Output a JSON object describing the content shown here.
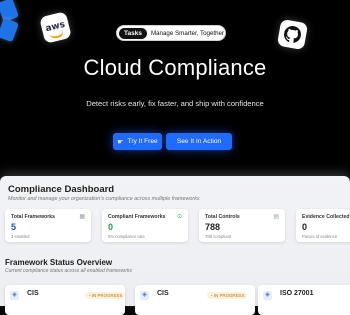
{
  "hero": {
    "pill_tag": "Tasks",
    "pill_text": "Manage Smarter, Together",
    "pill_arrow": "→",
    "title": "Cloud Compliance",
    "subtitle": "Detect risks early, fix faster, and ship with confidence",
    "try_label": "Try It Free",
    "see_label": "See It In Action",
    "aws_logo_text": "aws"
  },
  "dashboard": {
    "title": "Compliance Dashboard",
    "subtitle": "Monitor and manage your organization's compliance across multiple frameworks",
    "cards": [
      {
        "label": "Total Frameworks",
        "value": "5",
        "note": "3 enabled",
        "color": "#1f4fd8",
        "icon": "grid-icon"
      },
      {
        "label": "Compliant Frameworks",
        "value": "0",
        "note": "0% compliance rate",
        "color": "#1f9d55",
        "icon": "check-icon"
      },
      {
        "label": "Total Controls",
        "value": "788",
        "note": "788 compliant",
        "color": "#222222",
        "icon": "list-icon"
      },
      {
        "label": "Evidence Collected",
        "value": "0",
        "note": "Pieces of evidence",
        "color": "#222222",
        "icon": "doc-icon"
      }
    ],
    "framework_title": "Framework Status Overview",
    "framework_subtitle": "Current compliance status across all enabled frameworks",
    "frameworks": [
      {
        "name": "CIS",
        "status": "IN PROGRESS"
      },
      {
        "name": "CIS",
        "status": "IN PROGRESS"
      },
      {
        "name": "ISO 27001",
        "status": "IN PROGRESS"
      }
    ]
  }
}
